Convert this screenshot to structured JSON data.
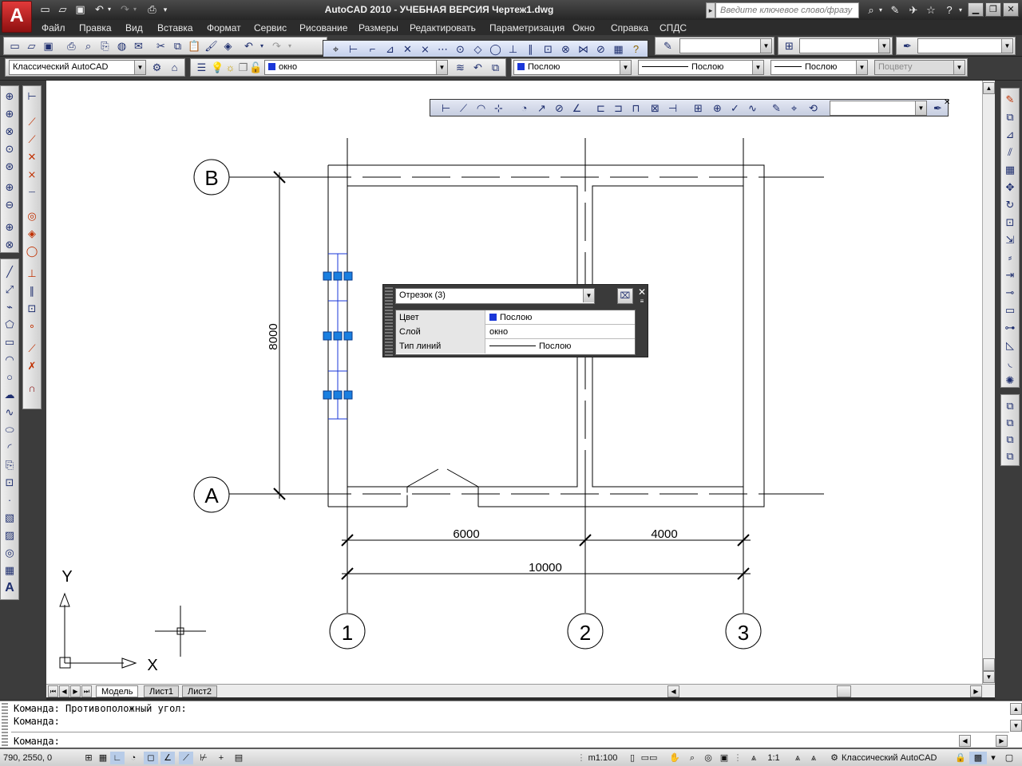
{
  "app": {
    "logo_letter": "A",
    "title": "AutoCAD 2010 - УЧЕБНАЯ ВЕРСИЯ    Чертеж1.dwg"
  },
  "search": {
    "placeholder": "Введите ключевое слово/фразу"
  },
  "menu": [
    "Файл",
    "Правка",
    "Вид",
    "Вставка",
    "Формат",
    "Сервис",
    "Рисование",
    "Размеры",
    "Редактировать",
    "Параметризация",
    "Окно",
    "Справка",
    "СПДС"
  ],
  "toolbars": {
    "workspace": "Классический AutoCAD",
    "layer": "окно",
    "color": "Послою",
    "linetype": "Послою",
    "lineweight": "Послою",
    "plotstyle": "Поцвету"
  },
  "drawing": {
    "grid_bubbles": {
      "row_b": "B",
      "row_a": "A",
      "col_1": "1",
      "col_2": "2",
      "col_3": "3"
    },
    "dimensions": {
      "vertical": "8000",
      "span_1_2": "6000",
      "span_2_3": "4000",
      "total": "10000"
    },
    "ucs": {
      "x": "X",
      "y": "Y"
    }
  },
  "quick_properties": {
    "selection": "Отрезок (3)",
    "rows": [
      {
        "prop": "Цвет",
        "value": "Послою"
      },
      {
        "prop": "Слой",
        "value": "окно"
      },
      {
        "prop": "Тип линий",
        "value": "Послою"
      }
    ]
  },
  "tabs": {
    "model": "Модель",
    "sheet1": "Лист1",
    "sheet2": "Лист2"
  },
  "command": {
    "line1": "Команда: Противоположный угол:",
    "line2": "Команда:",
    "prompt": "Команда:"
  },
  "status": {
    "coords": "790, 2550, 0",
    "scale_label": "m1:100",
    "annot_scale": "1:1",
    "workspace": "Классический AutoCAD"
  },
  "colors": {
    "accent": "#1a37d8",
    "grip": "#1a7fe0",
    "chrome": "#2c2c2c"
  }
}
